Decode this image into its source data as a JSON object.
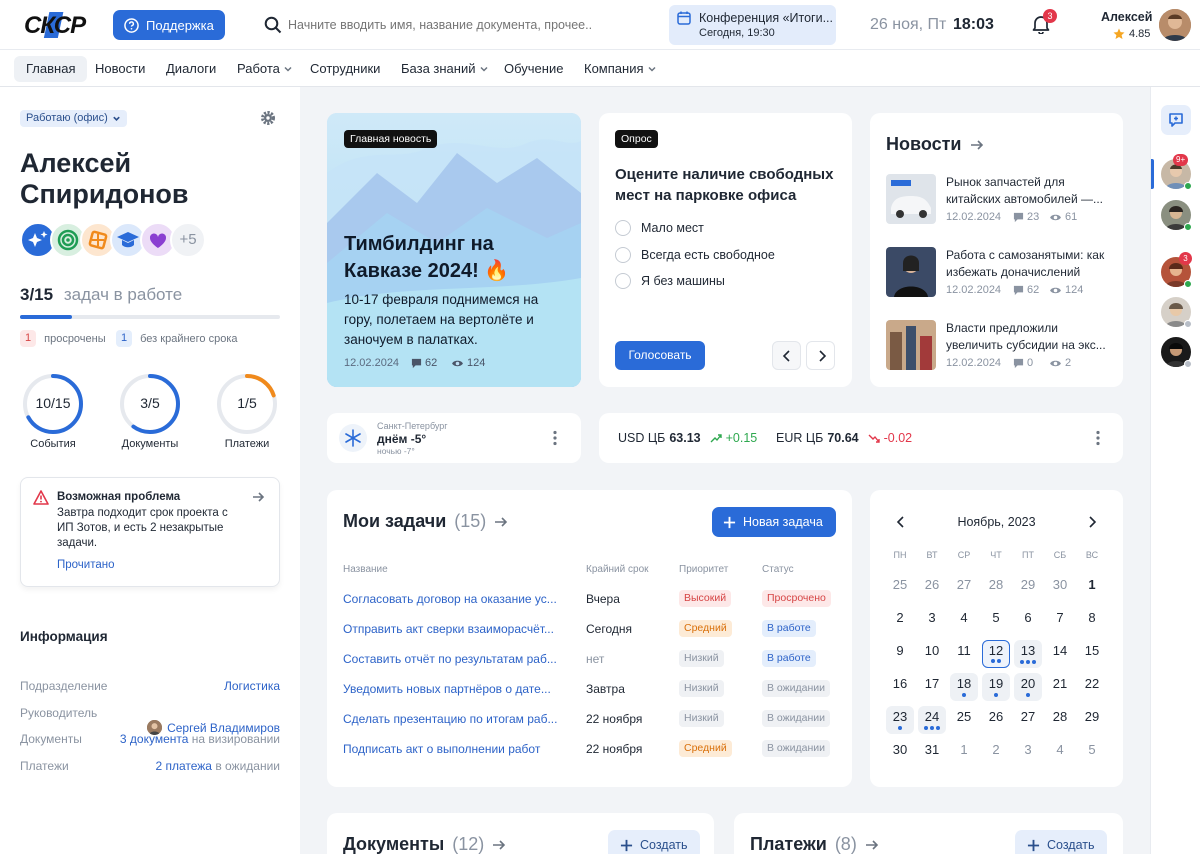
{
  "topbar": {
    "logo": "СКСР",
    "support_label": "Поддержка",
    "search_placeholder": "Начните вводить имя, название документа, прочее...",
    "event": {
      "title": "Конференция «Итоги...",
      "time": "Сегодня, 19:30"
    },
    "date": "26 ноя, Пт",
    "time": "18:03",
    "notifications": "3",
    "user_name": "Алексей",
    "user_rating": "4.85"
  },
  "nav": {
    "items": [
      "Главная",
      "Новости",
      "Диалоги",
      "Работа",
      "Сотрудники",
      "База знаний",
      "Обучение",
      "Компания"
    ]
  },
  "profile": {
    "status": "Работаю (офис)",
    "first_name": "Алексей",
    "last_name": "Спиридонов",
    "extra_badges": "+5",
    "tasks_count": "3/15",
    "tasks_label": "задач в работе",
    "overdue_count": "1",
    "overdue_label": "просрочены",
    "nodeadline_count": "1",
    "nodeadline_label": "без крайнего срока",
    "progress": 0.2
  },
  "rings": [
    {
      "value": "10/15",
      "label": "События",
      "fraction": 0.67,
      "color": "#2a6bd8"
    },
    {
      "value": "3/5",
      "label": "Документы",
      "fraction": 0.6,
      "color": "#2a6bd8"
    },
    {
      "value": "1/5",
      "label": "Платежи",
      "fraction": 0.2,
      "color": "#f08a1c"
    }
  ],
  "alert": {
    "title": "Возможная проблема",
    "text": "Завтра подходит срок проекта с ИП Зотов, и есть 2 незакрытые задачи.",
    "action": "Прочитано"
  },
  "info": {
    "title": "Информация",
    "rows": [
      {
        "label": "Подразделение",
        "value": "Логистика",
        "suffix": ""
      },
      {
        "label": "Руководитель",
        "value": "Сергей Владимиров",
        "suffix": ""
      },
      {
        "label": "Документы",
        "value": "3 документа",
        "suffix": "на визировании"
      },
      {
        "label": "Платежи",
        "value": "2 платежа",
        "suffix": "в ожидании"
      }
    ]
  },
  "hero": {
    "tag": "Главная новость",
    "title": "Тимбилдинг на Кавказе 2024! 🔥",
    "text": "10-17 февраля поднимемся на гору, полетаем на вертолёте и заночуем в палатках.",
    "date": "12.02.2024",
    "comments": "62",
    "views": "124"
  },
  "poll": {
    "tag": "Опрос",
    "question": "Оцените наличие свободных мест на парковке офиса",
    "options": [
      "Мало мест",
      "Всегда есть свободное",
      "Я без машины"
    ],
    "vote_label": "Голосовать"
  },
  "news": {
    "title": "Новости",
    "items": [
      {
        "title": "Рынок запчастей для китайских автомобилей —...",
        "date": "12.02.2024",
        "comments": "23",
        "views": "61"
      },
      {
        "title": "Работа с самозанятыми: как избежать доначислений",
        "date": "12.02.2024",
        "comments": "62",
        "views": "124"
      },
      {
        "title": "Власти предложили увеличить субсидии на экс...",
        "date": "12.02.2024",
        "comments": "0",
        "views": "2"
      }
    ]
  },
  "weather": {
    "city": "Санкт-Петербург",
    "day": "днём -5°",
    "night": "ночью -7°"
  },
  "currency": {
    "usd_label": "USD ЦБ",
    "usd_value": "63.13",
    "usd_change": "+0.15",
    "eur_label": "EUR ЦБ",
    "eur_value": "70.64",
    "eur_change": "-0.02"
  },
  "tasks": {
    "title": "Мои задачи",
    "count": "(15)",
    "new_label": "Новая задача",
    "headers": [
      "Название",
      "Крайний срок",
      "Приоритет",
      "Статус"
    ],
    "rows": [
      {
        "name": "Согласовать договор на оказание ус...",
        "deadline": "Вчера",
        "priority": "Высокий",
        "pclass": "b-red",
        "status": "Просрочено",
        "sclass": "b-red",
        "muted": false
      },
      {
        "name": "Отправить акт сверки взаиморасчёт...",
        "deadline": "Сегодня",
        "priority": "Средний",
        "pclass": "b-orange",
        "status": "В работе",
        "sclass": "b-blue",
        "muted": false
      },
      {
        "name": "Составить отчёт по результатам раб...",
        "deadline": "нет",
        "priority": "Низкий",
        "pclass": "b-gray",
        "status": "В работе",
        "sclass": "b-blue",
        "muted": true
      },
      {
        "name": "Уведомить новых партнёров о дате...",
        "deadline": "Завтра",
        "priority": "Низкий",
        "pclass": "b-gray",
        "status": "В ожидании",
        "sclass": "b-gray",
        "muted": false
      },
      {
        "name": "Сделать презентацию по итогам раб...",
        "deadline": "22 ноября",
        "priority": "Низкий",
        "pclass": "b-gray",
        "status": "В ожидании",
        "sclass": "b-gray",
        "muted": false
      },
      {
        "name": "Подписать акт о выполнении работ",
        "deadline": "22 ноября",
        "priority": "Средний",
        "pclass": "b-orange",
        "status": "В ожидании",
        "sclass": "b-gray",
        "muted": false
      }
    ]
  },
  "calendar": {
    "month": "Ноябрь, 2023",
    "weekdays": [
      "ПН",
      "ВТ",
      "СР",
      "ЧТ",
      "ПТ",
      "СБ",
      "ВС"
    ],
    "weeks": [
      [
        {
          "d": "25",
          "m": 1
        },
        {
          "d": "26",
          "m": 1
        },
        {
          "d": "27",
          "m": 1
        },
        {
          "d": "28",
          "m": 1
        },
        {
          "d": "29",
          "m": 1
        },
        {
          "d": "30",
          "m": 1
        },
        {
          "d": "1"
        }
      ],
      [
        {
          "d": "2"
        },
        {
          "d": "3"
        },
        {
          "d": "4"
        },
        {
          "d": "5"
        },
        {
          "d": "6"
        },
        {
          "d": "7"
        },
        {
          "d": "8"
        }
      ],
      [
        {
          "d": "9"
        },
        {
          "d": "10"
        },
        {
          "d": "11"
        },
        {
          "d": "12",
          "t": 1,
          "dots": 2
        },
        {
          "d": "13",
          "h": 1,
          "dots": 3
        },
        {
          "d": "14"
        },
        {
          "d": "15"
        }
      ],
      [
        {
          "d": "16"
        },
        {
          "d": "17"
        },
        {
          "d": "18",
          "h": 1,
          "dots": 1
        },
        {
          "d": "19",
          "h": 1,
          "dots": 1
        },
        {
          "d": "20",
          "h": 1,
          "dots": 1
        },
        {
          "d": "21"
        },
        {
          "d": "22"
        }
      ],
      [
        {
          "d": "23",
          "h": 1,
          "dots": 1
        },
        {
          "d": "24",
          "h": 1,
          "dots": 3
        },
        {
          "d": "25"
        },
        {
          "d": "26"
        },
        {
          "d": "27"
        },
        {
          "d": "28"
        },
        {
          "d": "29"
        }
      ],
      [
        {
          "d": "30"
        },
        {
          "d": "31"
        },
        {
          "d": "1",
          "m": 1
        },
        {
          "d": "2",
          "m": 1
        },
        {
          "d": "3",
          "m": 1
        },
        {
          "d": "4",
          "m": 1
        },
        {
          "d": "5",
          "m": 1
        }
      ]
    ]
  },
  "documents": {
    "title": "Документы",
    "count": "(12)",
    "create_label": "Создать"
  },
  "payments": {
    "title": "Платежи",
    "count": "(8)",
    "create_label": "Создать"
  },
  "rail": {
    "badges": [
      "9+",
      "3"
    ]
  },
  "colors": {
    "accent": "#2a6bd8",
    "danger": "#e2374a",
    "orange": "#f08a1c",
    "green": "#2ea84f"
  }
}
